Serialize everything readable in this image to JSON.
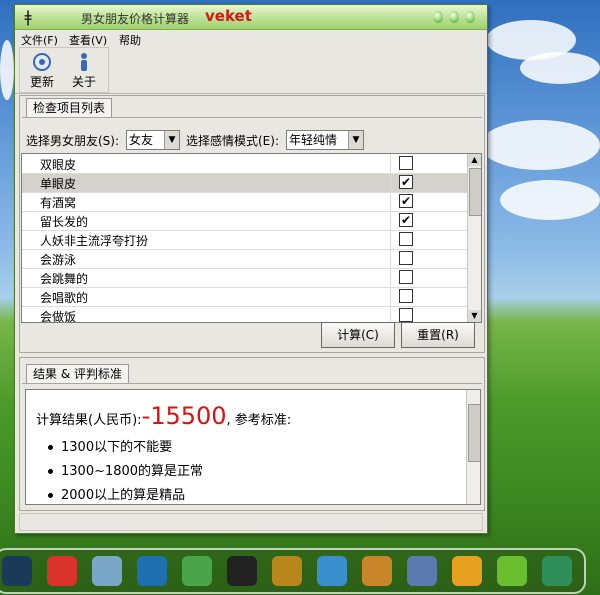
{
  "window": {
    "title": "男女朋友价格计算器",
    "brand": "veket",
    "app_icon_glyph": "ǂ"
  },
  "menu": [
    {
      "label": "文件(F)"
    },
    {
      "label": "查看(V)"
    },
    {
      "label": "帮助"
    }
  ],
  "toolbar": {
    "refresh_label": "更新",
    "refresh_icon": "refresh-icon",
    "about_label": "关于",
    "about_icon": "about-icon"
  },
  "check_panel": {
    "tab_label": "检查项目列表",
    "friend_label": "选择男女朋友(S):",
    "friend_value": "女友",
    "mode_label": "选择感情模式(E):",
    "mode_value": "年轻纯情",
    "items": [
      {
        "label": "双眼皮",
        "checked": false
      },
      {
        "label": "单眼皮",
        "checked": true,
        "selected": true
      },
      {
        "label": "有酒窝",
        "checked": true
      },
      {
        "label": "留长发的",
        "checked": true
      },
      {
        "label": "人妖非主流浮夸打扮",
        "checked": false
      },
      {
        "label": "会游泳",
        "checked": false
      },
      {
        "label": "会跳舞的",
        "checked": false
      },
      {
        "label": "会唱歌的",
        "checked": false
      },
      {
        "label": "会做饭",
        "checked": false
      }
    ],
    "calc_label": "计算(C)",
    "reset_label": "重置(R)"
  },
  "result_panel": {
    "tab_label": "结果 & 评判标准",
    "prefix": "计算结果(人民币):",
    "value": "-15500",
    "suffix": ", 参考标准:",
    "criteria": [
      "1300以下的不能要",
      "1300~1800的算是正常",
      "2000以上的算是精品"
    ]
  },
  "colors": {
    "title_gradient_top": "#e8f6d0",
    "title_gradient_bottom": "#9fd06c",
    "brand": "#d21818",
    "result_number": "#e01010"
  },
  "taskbar": {
    "icons": [
      "monitor-icon",
      "pig-icon",
      "notepad-icon",
      "media-player-icon",
      "users-icon",
      "qq-penguin-icon",
      "exit-door-icon",
      "image-viewer-icon",
      "paint-palette-icon",
      "pen-tool-icon",
      "game-icon",
      "help-icon",
      "camera-icon"
    ]
  }
}
